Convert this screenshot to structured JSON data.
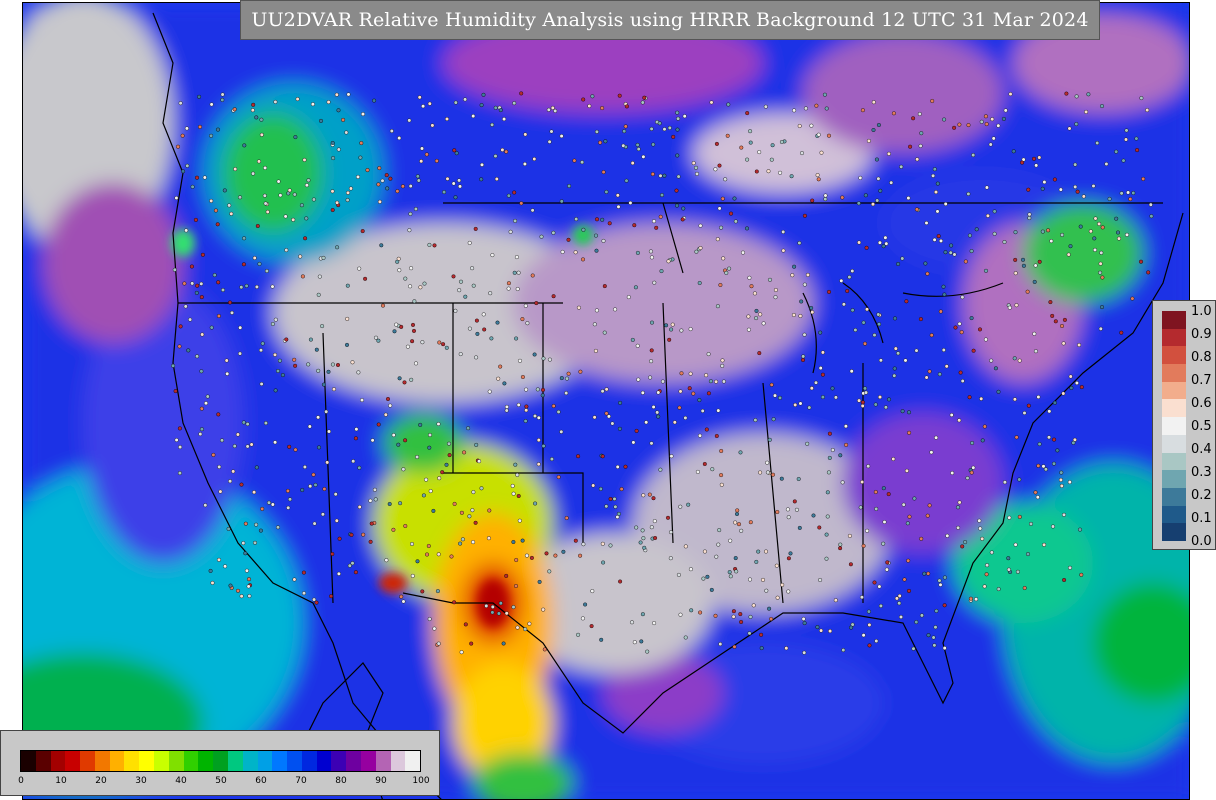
{
  "title": "UU2DVAR Relative Humidity Analysis using HRRR Background 12 UTC 31 Mar 2024",
  "obs_legend": {
    "labels": [
      "1.0",
      "0.9",
      "0.8",
      "0.7",
      "0.6",
      "0.5",
      "0.4",
      "0.3",
      "0.2",
      "0.1",
      "0.0"
    ],
    "colors": [
      "#7f1420",
      "#b42a2e",
      "#d2503e",
      "#e27b5c",
      "#f2ad8c",
      "#fadfd0",
      "#f2f2f2",
      "#d8dde0",
      "#a9c7c4",
      "#6fa6b0",
      "#3d7a9a",
      "#1f5a8a",
      "#163f70"
    ]
  },
  "rh_colorbar": {
    "tick_labels": [
      "0",
      "10",
      "20",
      "30",
      "40",
      "50",
      "60",
      "70",
      "80",
      "90",
      "100"
    ],
    "colors": [
      "#1a0000",
      "#5a0000",
      "#a30000",
      "#c80000",
      "#e03a00",
      "#f27800",
      "#ffb000",
      "#ffe000",
      "#ffff00",
      "#c8ff00",
      "#80e000",
      "#30d000",
      "#00b400",
      "#00a020",
      "#00c880",
      "#00b4c8",
      "#00a0e6",
      "#0078ff",
      "#0050f0",
      "#0028e0",
      "#0000d0",
      "#3c00b4",
      "#6e00a0",
      "#9600a0",
      "#b464b4",
      "#dcc8dc",
      "#f0f0f0"
    ]
  },
  "icons": [
    "map-canvas-icon"
  ]
}
